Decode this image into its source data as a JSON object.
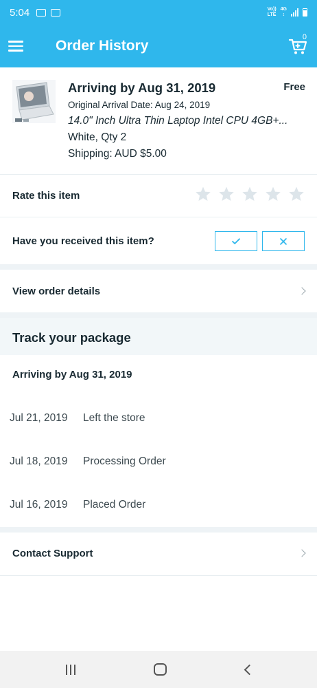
{
  "status_bar": {
    "time": "5:04",
    "net_top": "Vo))",
    "net_bottom": "LTE",
    "net_type": "4G"
  },
  "app_bar": {
    "title": "Order History",
    "cart_count": "0",
    "menu_icon": "hamburger-menu-icon",
    "cart_icon": "shopping-cart-icon"
  },
  "order": {
    "arriving": "Arriving by Aug 31, 2019",
    "price": "Free",
    "original_date": "Original Arrival Date: Aug 24, 2019",
    "product_name": "14.0\" Inch Ultra Thin Laptop Intel CPU 4GB+...",
    "variant": "White, Qty 2",
    "shipping": "Shipping: AUD $5.00"
  },
  "rate": {
    "label": "Rate this item",
    "stars_total": 5,
    "stars_filled": 0
  },
  "received": {
    "label": "Have you received this item?"
  },
  "view_details": {
    "label": "View order details"
  },
  "tracking": {
    "title": "Track your package",
    "arriving": "Arriving by Aug 31, 2019",
    "events": [
      {
        "date": "Jul 21, 2019",
        "text": "Left the store"
      },
      {
        "date": "Jul 18, 2019",
        "text": "Processing Order"
      },
      {
        "date": "Jul 16, 2019",
        "text": "Placed Order"
      }
    ]
  },
  "support": {
    "label": "Contact Support"
  },
  "colors": {
    "accent": "#2fb7ec",
    "text": "#192a32",
    "star": "#dde5ea",
    "divider": "#eef3f6"
  }
}
